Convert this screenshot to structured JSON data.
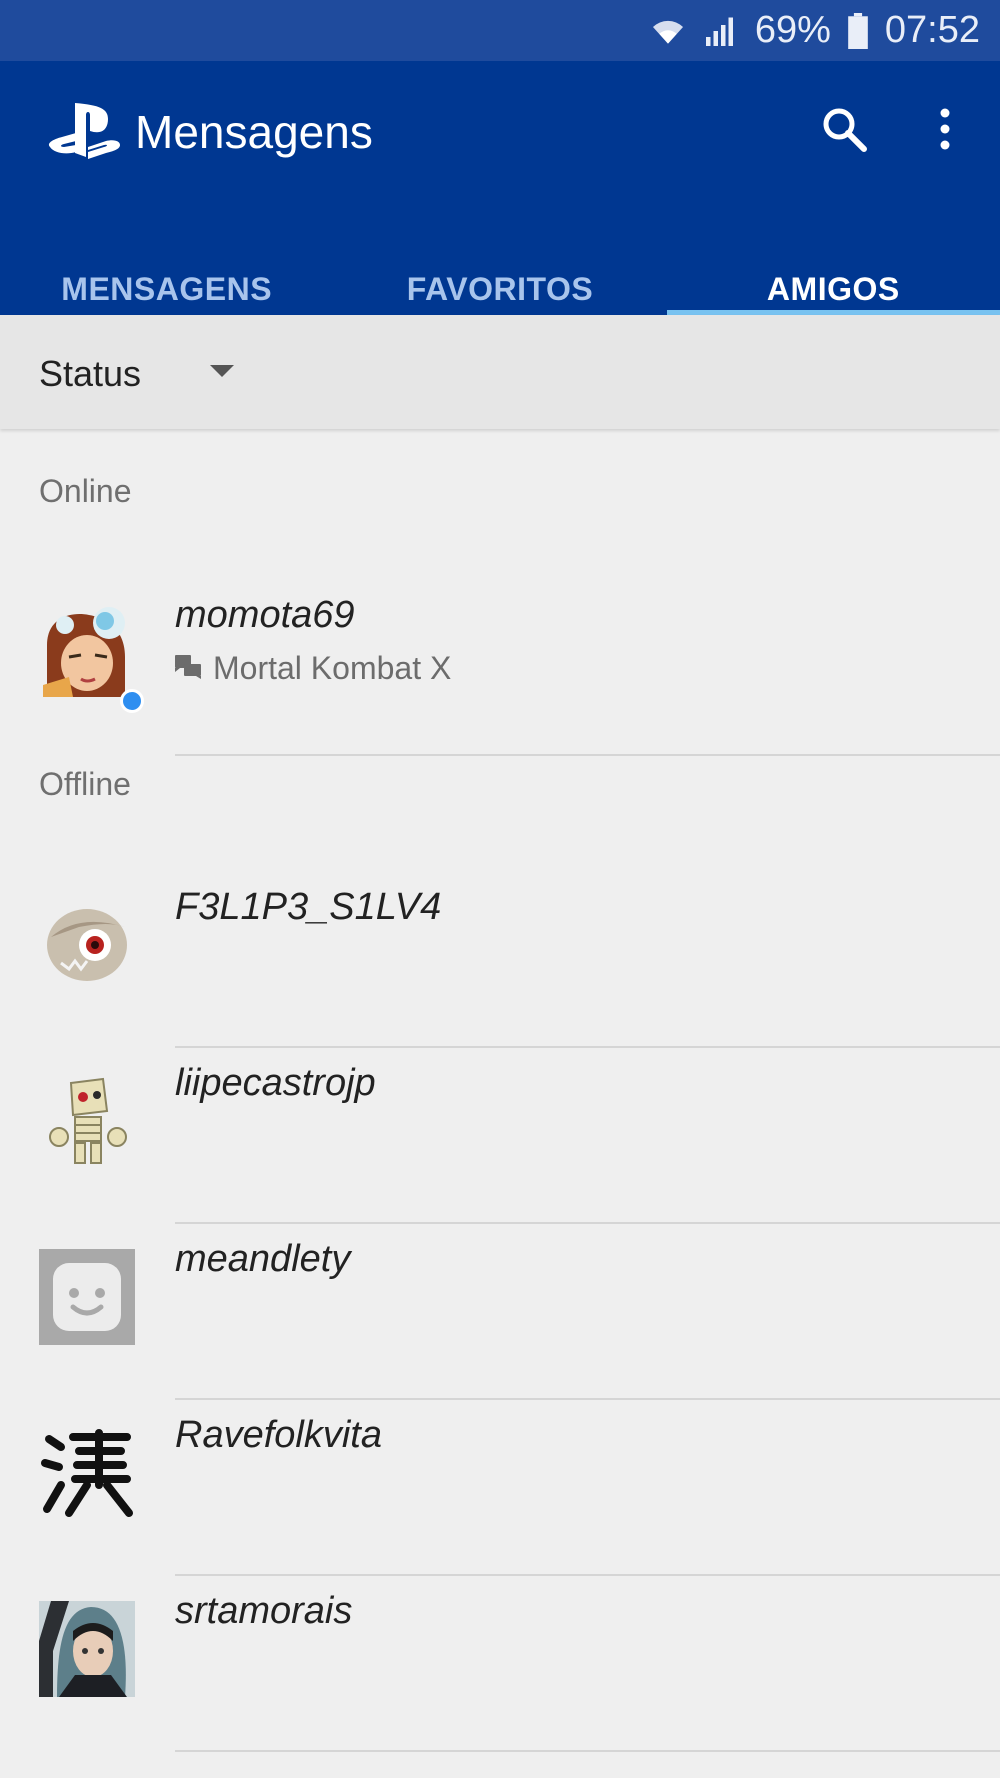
{
  "statusbar": {
    "battery": "69%",
    "time": "07:52"
  },
  "appbar": {
    "title": "Mensagens"
  },
  "tabs": [
    {
      "label": "MENSAGENS"
    },
    {
      "label": "FAVORITOS"
    },
    {
      "label": "AMIGOS"
    }
  ],
  "filter": {
    "label": "Status"
  },
  "sections": {
    "online": "Online",
    "offline": "Offline"
  },
  "friends": [
    {
      "name": "momota69",
      "game": "Mortal Kombat X",
      "status": "online"
    },
    {
      "name": "F3L1P3_S1LV4",
      "status": "offline"
    },
    {
      "name": "liipecastrojp",
      "status": "offline"
    },
    {
      "name": "meandlety",
      "status": "offline"
    },
    {
      "name": "Ravefolkvita",
      "status": "offline"
    },
    {
      "name": "srtamorais",
      "status": "offline"
    }
  ],
  "colors": {
    "statusbar": "#1f4b9d",
    "appbar": "#003791",
    "tab_indicator": "#78c2f0",
    "online_dot": "#2e8ef0"
  }
}
